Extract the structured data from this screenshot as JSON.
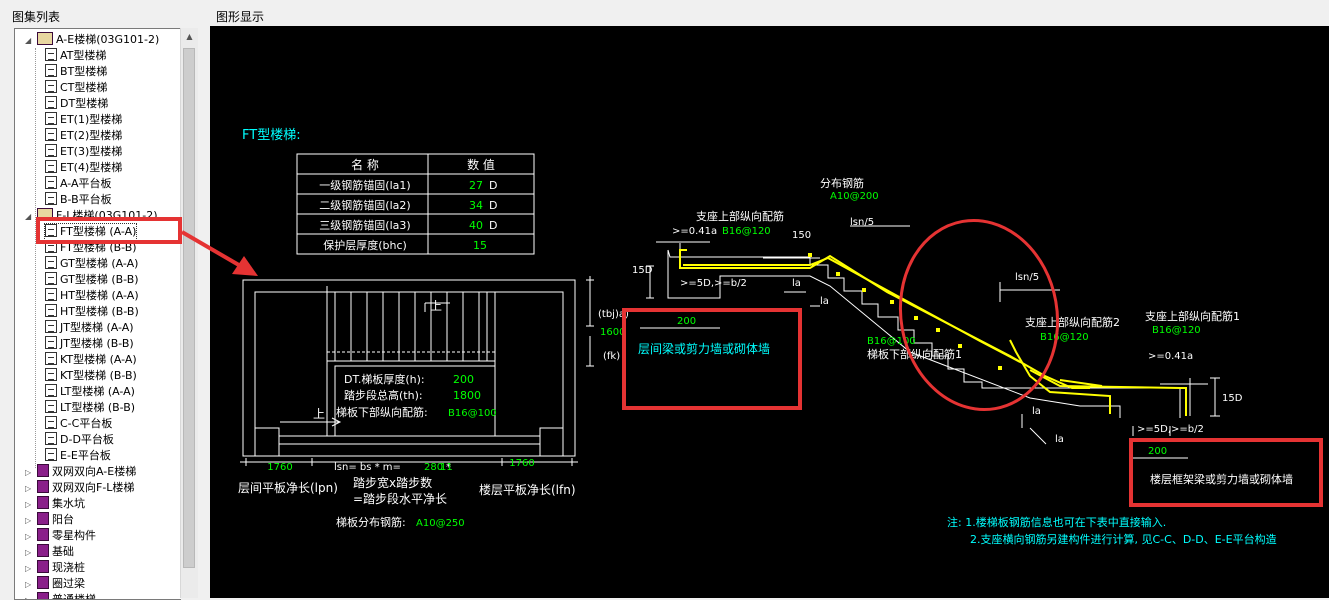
{
  "left_panel": {
    "title": "图集列表",
    "tree": [
      {
        "label": "A-E楼梯(03G101-2)",
        "level": 0,
        "icon": "book-open-icon",
        "expanded": true
      },
      {
        "label": "AT型楼梯",
        "level": 1,
        "icon": "document-icon"
      },
      {
        "label": "BT型楼梯",
        "level": 1,
        "icon": "document-icon"
      },
      {
        "label": "CT型楼梯",
        "level": 1,
        "icon": "document-icon"
      },
      {
        "label": "DT型楼梯",
        "level": 1,
        "icon": "document-icon"
      },
      {
        "label": "ET(1)型楼梯",
        "level": 1,
        "icon": "document-icon"
      },
      {
        "label": "ET(2)型楼梯",
        "level": 1,
        "icon": "document-icon"
      },
      {
        "label": "ET(3)型楼梯",
        "level": 1,
        "icon": "document-icon"
      },
      {
        "label": "ET(4)型楼梯",
        "level": 1,
        "icon": "document-icon"
      },
      {
        "label": "A-A平台板",
        "level": 1,
        "icon": "document-icon"
      },
      {
        "label": "B-B平台板",
        "level": 1,
        "icon": "document-icon"
      },
      {
        "label": "F-L楼梯(03G101-2)",
        "level": 0,
        "icon": "book-open-icon",
        "expanded": true
      },
      {
        "label": "FT型楼梯 (A-A)",
        "level": 1,
        "icon": "document-icon",
        "selected": true
      },
      {
        "label": "FT型楼梯 (B-B)",
        "level": 1,
        "icon": "document-icon"
      },
      {
        "label": "GT型楼梯 (A-A)",
        "level": 1,
        "icon": "document-icon"
      },
      {
        "label": "GT型楼梯 (B-B)",
        "level": 1,
        "icon": "document-icon"
      },
      {
        "label": "HT型楼梯 (A-A)",
        "level": 1,
        "icon": "document-icon"
      },
      {
        "label": "HT型楼梯 (B-B)",
        "level": 1,
        "icon": "document-icon"
      },
      {
        "label": "JT型楼梯 (A-A)",
        "level": 1,
        "icon": "document-icon"
      },
      {
        "label": "JT型楼梯 (B-B)",
        "level": 1,
        "icon": "document-icon"
      },
      {
        "label": "KT型楼梯 (A-A)",
        "level": 1,
        "icon": "document-icon"
      },
      {
        "label": "KT型楼梯 (B-B)",
        "level": 1,
        "icon": "document-icon"
      },
      {
        "label": "LT型楼梯 (A-A)",
        "level": 1,
        "icon": "document-icon"
      },
      {
        "label": "LT型楼梯 (B-B)",
        "level": 1,
        "icon": "document-icon"
      },
      {
        "label": "C-C平台板",
        "level": 1,
        "icon": "document-icon"
      },
      {
        "label": "D-D平台板",
        "level": 1,
        "icon": "document-icon"
      },
      {
        "label": "E-E平台板",
        "level": 1,
        "icon": "document-icon"
      },
      {
        "label": "双网双向A-E楼梯",
        "level": 0,
        "icon": "book-icon"
      },
      {
        "label": "双网双向F-L楼梯",
        "level": 0,
        "icon": "book-icon"
      },
      {
        "label": "集水坑",
        "level": 0,
        "icon": "book-icon"
      },
      {
        "label": "阳台",
        "level": 0,
        "icon": "book-icon"
      },
      {
        "label": "零星构件",
        "level": 0,
        "icon": "book-icon"
      },
      {
        "label": "基础",
        "level": 0,
        "icon": "book-icon"
      },
      {
        "label": "现浇桩",
        "level": 0,
        "icon": "book-icon"
      },
      {
        "label": "圈过梁",
        "level": 0,
        "icon": "book-icon"
      },
      {
        "label": "普通楼梯",
        "level": 0,
        "icon": "book-icon"
      }
    ]
  },
  "right_panel": {
    "title": "图形显示",
    "drawing": {
      "heading": "FT型楼梯:",
      "param_table": {
        "headers": [
          "名 称",
          "数 值"
        ],
        "rows": [
          {
            "name": "一级钢筋锚固(la1)",
            "value": "27",
            "unit": "D"
          },
          {
            "name": "二级钢筋锚固(la2)",
            "value": "34",
            "unit": "D"
          },
          {
            "name": "三级钢筋锚固(la3)",
            "value": "40",
            "unit": "D"
          },
          {
            "name": "保护层厚度(bhc)",
            "value": "15",
            "unit": ""
          }
        ]
      },
      "plan": {
        "label_thickness": "DT.梯板厚度(h):",
        "val_thickness": "200",
        "label_height": "踏步段总高(th):",
        "val_height": "1800",
        "label_bottom_bar": "梯板下部纵向配筋:",
        "val_bottom_bar": "B16@100",
        "tag_up_top": "上",
        "tag_up_bottom": "上",
        "dim_left": "1760",
        "dim_right": "1760",
        "dim_mid_prefix": "lsn= bs * m=",
        "dim_mid_bs": "280",
        "dim_mid_star": "*",
        "dim_mid_m": "11",
        "label_left_platform": "层间平板净长(lpn)",
        "label_step_1": "踏步宽x踏步数",
        "label_step_2": "=踏步段水平净长",
        "label_right_platform": "楼层平板净长(lfn)",
        "label_dist_bar": "梯板分布钢筋:",
        "val_dist_bar": "A10@250",
        "label_tbj": "(tbj)a)",
        "val_tbj": "1600",
        "label_fk": "(fk)"
      },
      "section": {
        "label_dist": "分布钢筋",
        "val_dist": "A10@200",
        "label_top_bar_left": "支座上部纵向配筋",
        "val_top_bar_left": "B16@120",
        "label_041a_left": ">=0.41a",
        "label_150": "150",
        "label_lsn5_top": "lsn/5",
        "label_lsn5_mid": "lsn/5",
        "label_15d_left": "15D",
        "label_5d_left": ">=5D,>=b/2",
        "label_la_1": "la",
        "label_la_2": "la",
        "label_200_left": "200",
        "label_beam_left": "层间梁或剪力墙或砌体墙",
        "label_bottom_val": "B16@100",
        "label_bottom": "梯板下部纵向配筋1",
        "label_top_bar_2": "支座上部纵向配筋2",
        "val_top_bar_2": "B16@120",
        "label_top_bar_1": "支座上部纵向配筋1",
        "val_top_bar_1": "B16@120",
        "label_041a_right": ">=0.41a",
        "label_15d_right": "15D",
        "label_la_3": "la",
        "label_la_4": "la",
        "label_5d_right": ">=5D,>=b/2",
        "label_200_right": "200",
        "label_beam_right": "楼层框架梁或剪力墙或砌体墙"
      },
      "notes": {
        "line1": "注: 1.楼梯板钢筋信息也可在下表中直接输入.",
        "line2": "2.支座横向钢筋另建构件进行计算, 见C-C、D-D、E-E平台构造"
      }
    }
  },
  "colors": {
    "cad_background": "#000000",
    "cad_white": "#ffffff",
    "cad_yellow": "#ffff00",
    "cad_green": "#00ff00",
    "cad_cyan": "#00ffff",
    "annotation_red": "#e53333"
  }
}
